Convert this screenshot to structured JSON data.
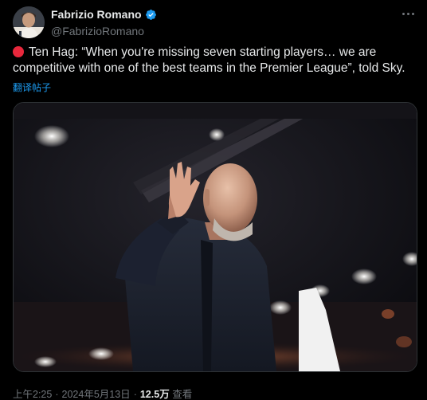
{
  "author": {
    "display_name": "Fabrizio Romano",
    "handle": "@FabrizioRomano",
    "verified": true,
    "verified_icon": "verified-badge-icon",
    "avatar_icon": "avatar-photo"
  },
  "tweet": {
    "emoji_icon": "red-circle-icon",
    "text": "Ten Hag: “When you're missing seven starting players… we are competitive with one of the best teams in the Premier League”, told Sky.",
    "translate_label": "翻译帖子",
    "media_alt_icon": "photo-ten-hag-waving"
  },
  "meta": {
    "time": "上午2:25",
    "separator": "·",
    "date": "2024年5月13日",
    "separator2": "·",
    "views_count": "12.5万",
    "views_label": "查看"
  },
  "colors": {
    "background": "#000000",
    "text_primary": "#e7e9ea",
    "text_secondary": "#71767b",
    "accent": "#1d9bf0",
    "verified": "#1d9bf0",
    "red_circle": "#e8283c"
  }
}
